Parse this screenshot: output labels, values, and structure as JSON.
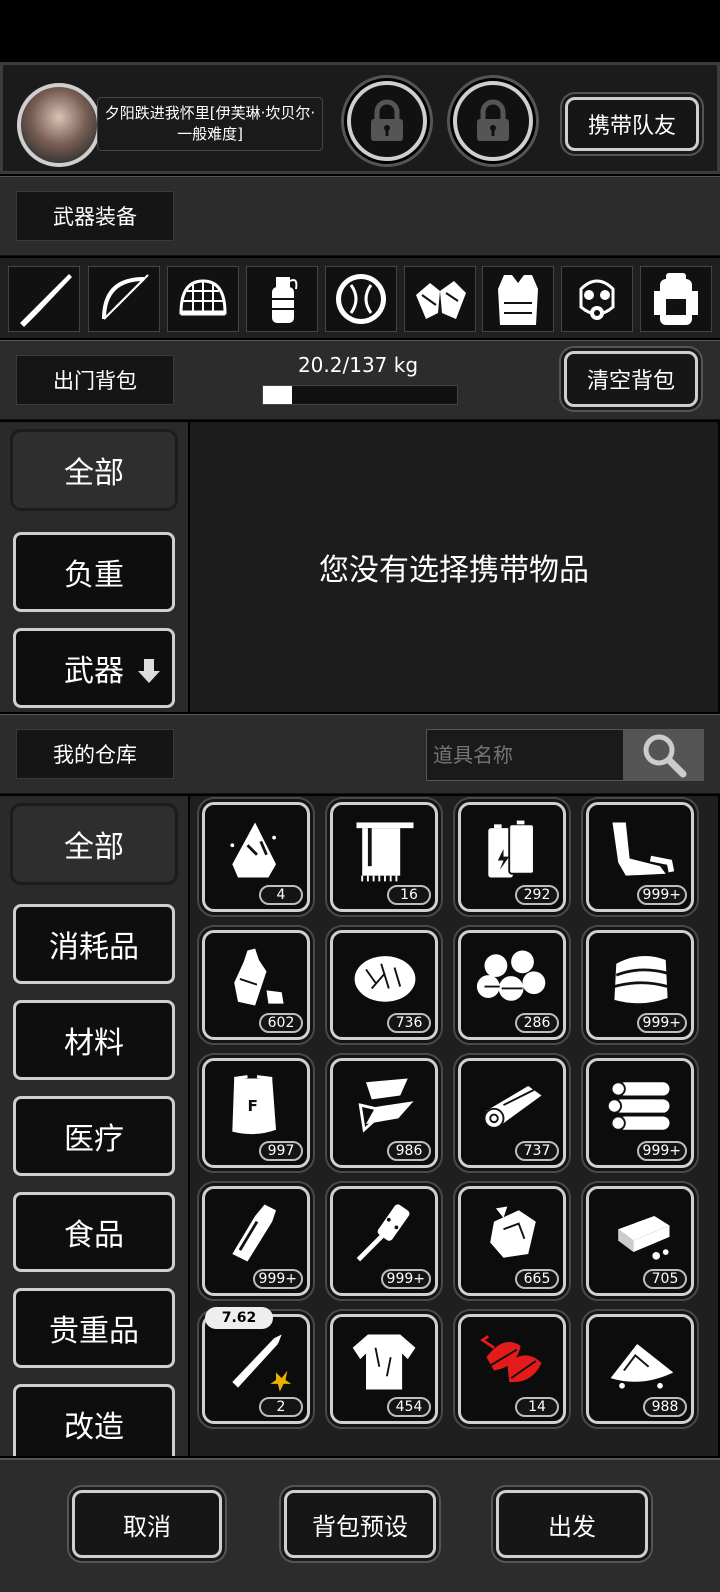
{
  "header": {
    "character_name": "夕阳跌进我怀里[伊芙琳·坎贝尔·一般难度]",
    "carry_teammate_label": "携带队友"
  },
  "equipment": {
    "title": "武器装备",
    "slots": [
      "knife-icon",
      "bow-icon",
      "net-helmet-icon",
      "grenade-icon",
      "shield-icon",
      "gloves-icon",
      "vest-icon",
      "gas-mask-icon",
      "backpack-icon"
    ]
  },
  "backpack": {
    "title": "出门背包",
    "weight_text": "20.2/137 kg",
    "weight_fraction": 0.147,
    "clear_label": "清空背包",
    "empty_message": "您没有选择携带物品",
    "tabs": [
      {
        "label": "全部",
        "active": true
      },
      {
        "label": "负重",
        "active": false
      },
      {
        "label": "武器",
        "active": false
      }
    ]
  },
  "warehouse": {
    "title": "我的仓库",
    "search_placeholder": "道具名称",
    "tabs": [
      {
        "label": "全部",
        "active": true
      },
      {
        "label": "消耗品",
        "active": false
      },
      {
        "label": "材料",
        "active": false
      },
      {
        "label": "医疗",
        "active": false
      },
      {
        "label": "食品",
        "active": false
      },
      {
        "label": "贵重品",
        "active": false
      },
      {
        "label": "改造",
        "active": false
      }
    ],
    "items": [
      {
        "icon": "cloth-scrap-icon",
        "count": "4"
      },
      {
        "icon": "towel-icon",
        "count": "16"
      },
      {
        "icon": "battery-icon",
        "count": "292"
      },
      {
        "icon": "pipe-scrap-icon",
        "count": "999+"
      },
      {
        "icon": "plastic-bottle-icon",
        "count": "602"
      },
      {
        "icon": "fiber-icon",
        "count": "736"
      },
      {
        "icon": "stones-icon",
        "count": "286"
      },
      {
        "icon": "fabric-icon",
        "count": "999+"
      },
      {
        "icon": "flour-bag-icon",
        "count": "997"
      },
      {
        "icon": "glass-shards-icon",
        "count": "986"
      },
      {
        "icon": "wood-plank-icon",
        "count": "737"
      },
      {
        "icon": "logs-icon",
        "count": "999+"
      },
      {
        "icon": "glass-bottle-icon",
        "count": "999+"
      },
      {
        "icon": "sandpaper-tool-icon",
        "count": "999+"
      },
      {
        "icon": "ore-icon",
        "count": "665"
      },
      {
        "icon": "brick-icon",
        "count": "705"
      },
      {
        "icon": "bullet-icon",
        "count": "2",
        "caliber": "7.62"
      },
      {
        "icon": "shirt-icon",
        "count": "454"
      },
      {
        "icon": "red-herb-icon",
        "count": "14"
      },
      {
        "icon": "powder-pile-icon",
        "count": "988"
      }
    ]
  },
  "footer": {
    "cancel_label": "取消",
    "preset_label": "背包预设",
    "depart_label": "出发"
  }
}
